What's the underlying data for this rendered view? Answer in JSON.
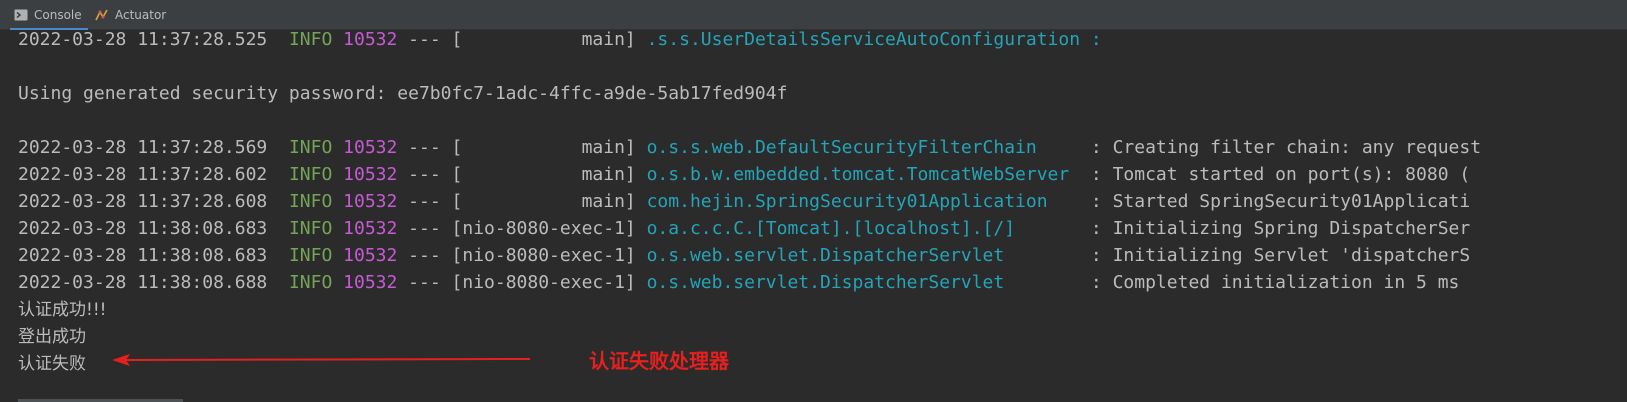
{
  "tabs": [
    {
      "label": "Console",
      "icon": "console-icon",
      "active": true
    },
    {
      "label": "Actuator",
      "icon": "actuator-icon",
      "active": false
    }
  ],
  "log": {
    "partial_line": {
      "date": "2022-03-28 11:37:28.525",
      "level": "INFO",
      "pid": "10532",
      "sep": "--- [           main]",
      "logger": ".s.s.UserDetailsServiceAutoConfiguration :"
    },
    "password_line": "Using generated security password: ee7b0fc7-1adc-4ffc-a9de-5ab17fed904f",
    "entries": [
      {
        "date": "2022-03-28 11:37:28.569",
        "level": "INFO",
        "pid": "10532",
        "sep": "--- [           main]",
        "logger": "o.s.s.web.DefaultSecurityFilterChain    ",
        "msg": " : Creating filter chain: any request"
      },
      {
        "date": "2022-03-28 11:37:28.602",
        "level": "INFO",
        "pid": "10532",
        "sep": "--- [           main]",
        "logger": "o.s.b.w.embedded.tomcat.TomcatWebServer ",
        "msg": " : Tomcat started on port(s): 8080 ("
      },
      {
        "date": "2022-03-28 11:37:28.608",
        "level": "INFO",
        "pid": "10532",
        "sep": "--- [           main]",
        "logger": "com.hejin.SpringSecurity01Application   ",
        "msg": " : Started SpringSecurity01Applicati"
      },
      {
        "date": "2022-03-28 11:38:08.683",
        "level": "INFO",
        "pid": "10532",
        "sep": "--- [nio-8080-exec-1]",
        "logger": "o.a.c.c.C.[Tomcat].[localhost].[/]      ",
        "msg": " : Initializing Spring DispatcherSer"
      },
      {
        "date": "2022-03-28 11:38:08.683",
        "level": "INFO",
        "pid": "10532",
        "sep": "--- [nio-8080-exec-1]",
        "logger": "o.s.web.servlet.DispatcherServlet       ",
        "msg": " : Initializing Servlet 'dispatcherS"
      },
      {
        "date": "2022-03-28 11:38:08.688",
        "level": "INFO",
        "pid": "10532",
        "sep": "--- [nio-8080-exec-1]",
        "logger": "o.s.web.servlet.DispatcherServlet       ",
        "msg": " : Completed initialization in 5 ms"
      }
    ],
    "outputs": [
      "认证成功!!!",
      "登出成功",
      "认证失败"
    ]
  },
  "annotation": {
    "text": "认证失败处理器",
    "color": "#e5201f"
  },
  "colors": {
    "level": "#73a556",
    "pid": "#c75ad4",
    "logger": "#24a4b8",
    "text": "#bbbbbb",
    "background": "#2b2b2b"
  }
}
